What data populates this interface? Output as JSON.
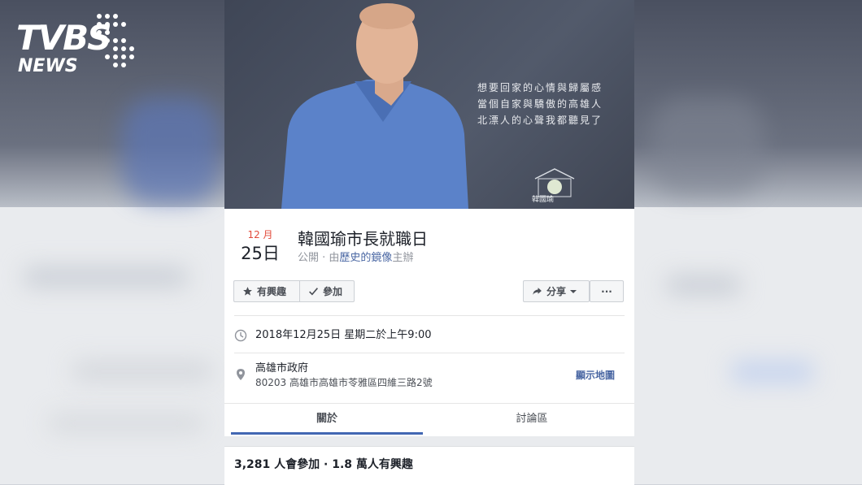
{
  "broadcaster_logo": {
    "primary": "TVBS",
    "secondary": "NEWS"
  },
  "cover": {
    "lines": [
      "想要回家的心情與歸屬感",
      "當個自家與驕傲的高雄人",
      "北漂人的心聲我都聽見了"
    ],
    "logo_text": "韓國瑜"
  },
  "event": {
    "date_month": "12 月",
    "date_day": "25日",
    "title": "韓國瑜市長就職日",
    "privacy": "公開",
    "host_prefix": "· 由",
    "host_name": "歷史的鏡像",
    "host_suffix": "主辦",
    "datetime": "2018年12月25日 星期二於上午9:00",
    "place_name": "高雄市政府",
    "place_address": "80203 高雄市高雄市苓雅區四維三路2號",
    "map_link": "顯示地圖",
    "attendance": "3,281 人會參加 · 1.8 萬人有興趣"
  },
  "actions": {
    "interested": "有興趣",
    "going": "參加",
    "share": "分享",
    "more": "···"
  },
  "tabs": {
    "about": "關於",
    "discussion": "討論區"
  },
  "colors": {
    "accent": "#4267b2",
    "date_red": "#e24b3b",
    "link": "#4a67a3"
  },
  "icons": [
    "star-icon",
    "check-icon",
    "share-arrow-icon",
    "caret-down-icon",
    "clock-icon",
    "location-pin-icon"
  ]
}
